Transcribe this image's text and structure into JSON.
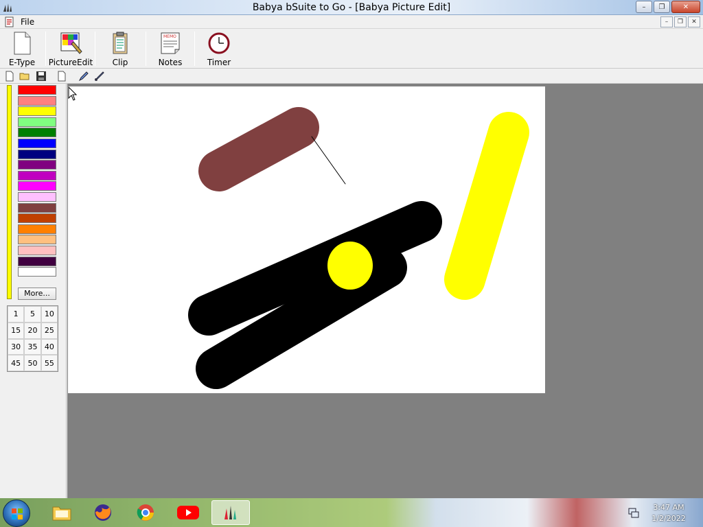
{
  "window": {
    "title": "Babya bSuite to Go - [Babya Picture Edit]"
  },
  "menu": {
    "file_label": "File"
  },
  "toolbar": {
    "buttons": [
      {
        "label": "E-Type",
        "icon": "document-icon"
      },
      {
        "label": "PictureEdit",
        "icon": "picture-edit-icon"
      },
      {
        "label": "Clip",
        "icon": "clipboard-icon"
      },
      {
        "label": "Notes",
        "icon": "memo-icon"
      },
      {
        "label": "Timer",
        "icon": "clock-icon"
      }
    ]
  },
  "small_tools": [
    "new-icon",
    "open-folder-icon",
    "save-icon",
    "page-icon",
    "pencil-icon",
    "brush-icon"
  ],
  "palette": {
    "current_color": "#ffff00",
    "colors": [
      "#ff0000",
      "#ff8080",
      "#ffff00",
      "#80ff80",
      "#008000",
      "#0000ff",
      "#000080",
      "#800080",
      "#c000c0",
      "#ff00ff",
      "#ffc0ff",
      "#804040",
      "#c04000",
      "#ff8000",
      "#ffc080",
      "#ffc0c0",
      "#400040",
      "#ffffff"
    ],
    "more_label": "More..."
  },
  "brush_sizes": [
    "1",
    "5",
    "10",
    "15",
    "20",
    "25",
    "30",
    "35",
    "40",
    "45",
    "50",
    "55"
  ],
  "canvas": {
    "background": "#ffffff",
    "strokes": [
      {
        "color": "#804040",
        "width": 60
      },
      {
        "color": "#000000",
        "width": 1
      },
      {
        "color": "#000000",
        "width": 60
      },
      {
        "color": "#000000",
        "width": 60
      },
      {
        "color": "#ffff00",
        "width": 60
      },
      {
        "color": "#ffff00",
        "width": 60
      }
    ]
  },
  "taskbar": {
    "apps": [
      "file-explorer-icon",
      "firefox-icon",
      "chrome-icon",
      "youtube-icon",
      "babya-bsuite-icon"
    ],
    "time": "3:47 AM",
    "date": "1/2/2022"
  }
}
